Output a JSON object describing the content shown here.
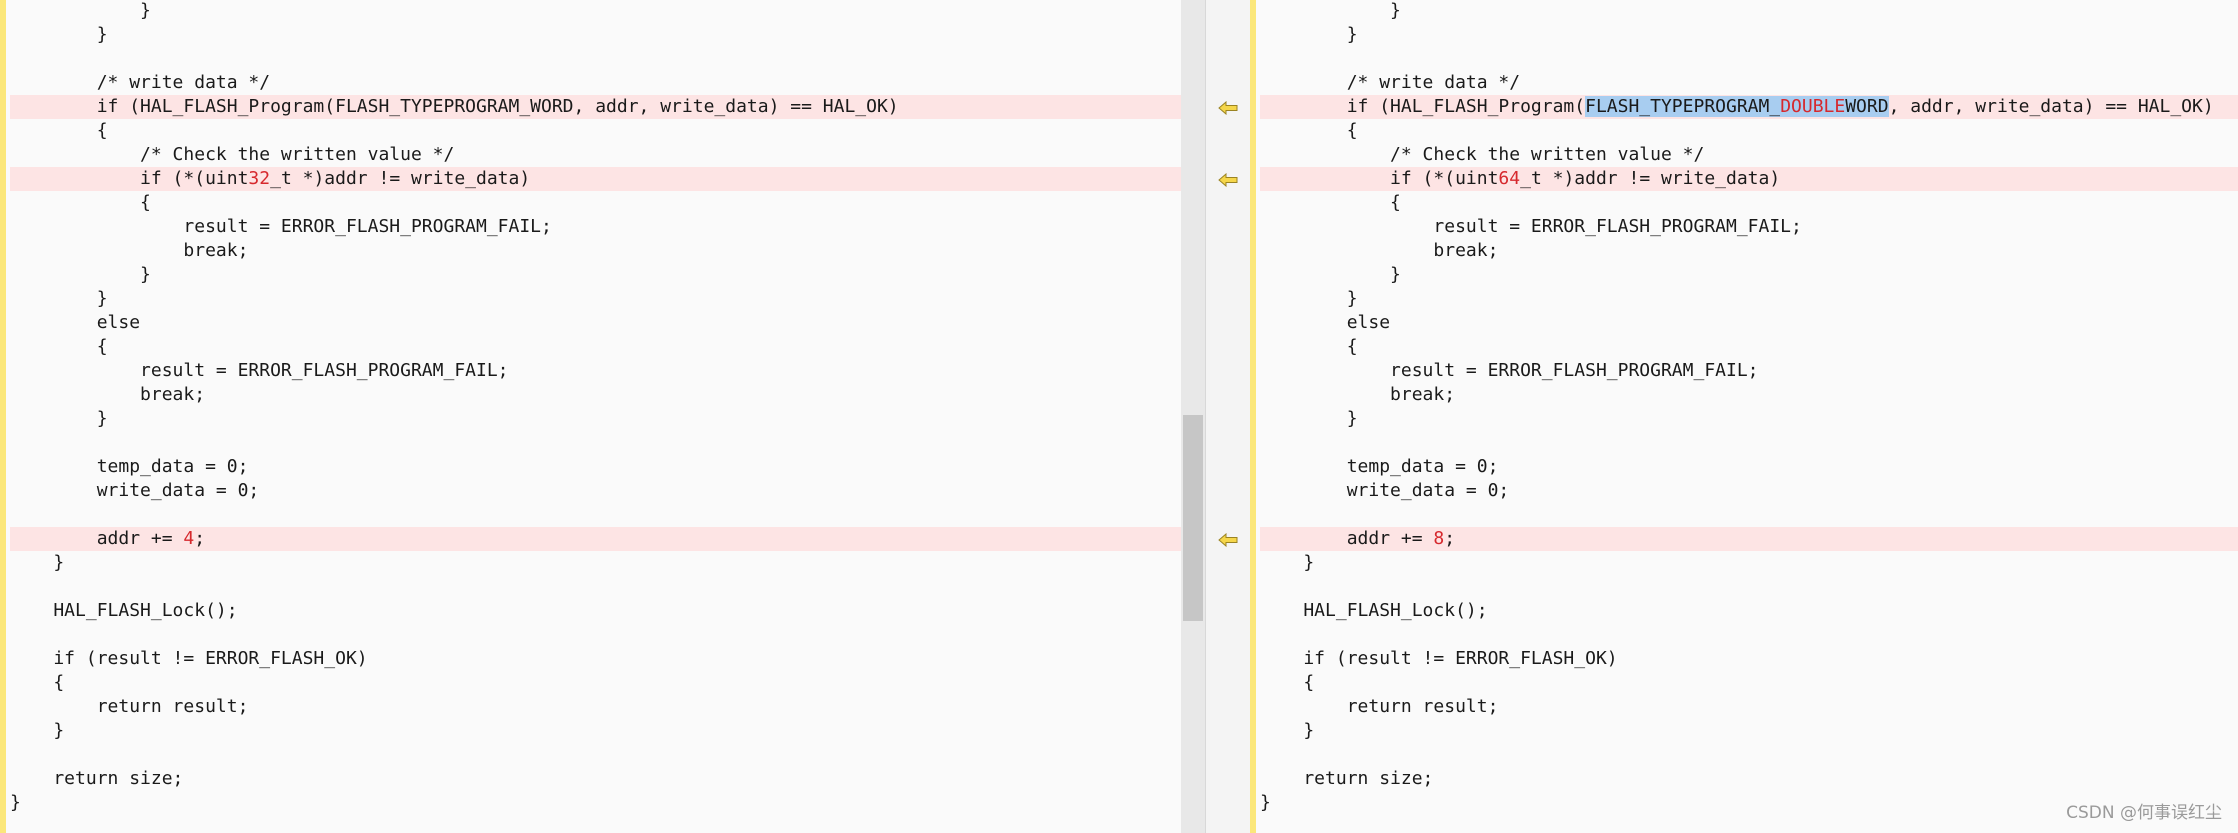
{
  "left_lines": [
    {
      "segments": [
        {
          "t": "            }"
        }
      ]
    },
    {
      "segments": [
        {
          "t": "        }"
        }
      ]
    },
    {
      "segments": [
        {
          "t": ""
        }
      ]
    },
    {
      "segments": [
        {
          "t": "        /* write data */"
        }
      ]
    },
    {
      "diff": true,
      "segments": [
        {
          "t": "        if (HAL_FLASH_Program(FLASH_TYPEPROGRAM_WORD, addr, write_data) == HAL_OK)"
        }
      ]
    },
    {
      "segments": [
        {
          "t": "        {"
        }
      ]
    },
    {
      "segments": [
        {
          "t": "            /* Check the written value */"
        }
      ]
    },
    {
      "diff": true,
      "segments": [
        {
          "t": "            if (*(uint"
        },
        {
          "t": "32",
          "c": "del"
        },
        {
          "t": "_t *)addr != write_data)"
        }
      ]
    },
    {
      "segments": [
        {
          "t": "            {"
        }
      ]
    },
    {
      "segments": [
        {
          "t": "                result = ERROR_FLASH_PROGRAM_FAIL;"
        }
      ]
    },
    {
      "segments": [
        {
          "t": "                break;"
        }
      ]
    },
    {
      "segments": [
        {
          "t": "            }"
        }
      ]
    },
    {
      "segments": [
        {
          "t": "        }"
        }
      ]
    },
    {
      "segments": [
        {
          "t": "        else"
        }
      ]
    },
    {
      "segments": [
        {
          "t": "        {"
        }
      ]
    },
    {
      "segments": [
        {
          "t": "            result = ERROR_FLASH_PROGRAM_FAIL;"
        }
      ]
    },
    {
      "segments": [
        {
          "t": "            break;"
        }
      ]
    },
    {
      "segments": [
        {
          "t": "        }"
        }
      ]
    },
    {
      "segments": [
        {
          "t": ""
        }
      ]
    },
    {
      "segments": [
        {
          "t": "        temp_data = 0;"
        }
      ]
    },
    {
      "segments": [
        {
          "t": "        write_data = 0;"
        }
      ]
    },
    {
      "segments": [
        {
          "t": ""
        }
      ]
    },
    {
      "diff": true,
      "segments": [
        {
          "t": "        addr += "
        },
        {
          "t": "4",
          "c": "del"
        },
        {
          "t": ";"
        }
      ]
    },
    {
      "segments": [
        {
          "t": "    }"
        }
      ]
    },
    {
      "segments": [
        {
          "t": ""
        }
      ]
    },
    {
      "segments": [
        {
          "t": "    HAL_FLASH_Lock();"
        }
      ]
    },
    {
      "segments": [
        {
          "t": ""
        }
      ]
    },
    {
      "segments": [
        {
          "t": "    if (result != ERROR_FLASH_OK)"
        }
      ]
    },
    {
      "segments": [
        {
          "t": "    {"
        }
      ]
    },
    {
      "segments": [
        {
          "t": "        return result;"
        }
      ]
    },
    {
      "segments": [
        {
          "t": "    }"
        }
      ]
    },
    {
      "segments": [
        {
          "t": ""
        }
      ]
    },
    {
      "segments": [
        {
          "t": "    return size;"
        }
      ]
    },
    {
      "segments": [
        {
          "t": "}"
        }
      ]
    }
  ],
  "right_lines": [
    {
      "segments": [
        {
          "t": "            }"
        }
      ]
    },
    {
      "segments": [
        {
          "t": "        }"
        }
      ]
    },
    {
      "segments": [
        {
          "t": ""
        }
      ]
    },
    {
      "segments": [
        {
          "t": "        /* write data */"
        }
      ]
    },
    {
      "diff": true,
      "segments": [
        {
          "t": "        if (HAL_FLASH_Program("
        },
        {
          "t": "FLASH_TYPEPROGRAM_",
          "c": "sel"
        },
        {
          "t": "DOUBLE",
          "c": "seldel"
        },
        {
          "t": "WORD",
          "c": "sel"
        },
        {
          "t": ", addr, write_data) == HAL_OK)"
        }
      ]
    },
    {
      "segments": [
        {
          "t": "        {"
        }
      ]
    },
    {
      "segments": [
        {
          "t": "            /* Check the written value */"
        }
      ]
    },
    {
      "diff": true,
      "segments": [
        {
          "t": "            if (*(uint"
        },
        {
          "t": "64",
          "c": "del"
        },
        {
          "t": "_t *)addr != write_data)"
        }
      ]
    },
    {
      "segments": [
        {
          "t": "            {"
        }
      ]
    },
    {
      "segments": [
        {
          "t": "                result = ERROR_FLASH_PROGRAM_FAIL;"
        }
      ]
    },
    {
      "segments": [
        {
          "t": "                break;"
        }
      ]
    },
    {
      "segments": [
        {
          "t": "            }"
        }
      ]
    },
    {
      "segments": [
        {
          "t": "        }"
        }
      ]
    },
    {
      "segments": [
        {
          "t": "        else"
        }
      ]
    },
    {
      "segments": [
        {
          "t": "        {"
        }
      ]
    },
    {
      "segments": [
        {
          "t": "            result = ERROR_FLASH_PROGRAM_FAIL;"
        }
      ]
    },
    {
      "segments": [
        {
          "t": "            break;"
        }
      ]
    },
    {
      "segments": [
        {
          "t": "        }"
        }
      ]
    },
    {
      "segments": [
        {
          "t": ""
        }
      ]
    },
    {
      "segments": [
        {
          "t": "        temp_data = 0;"
        }
      ]
    },
    {
      "segments": [
        {
          "t": "        write_data = 0;"
        }
      ]
    },
    {
      "segments": [
        {
          "t": ""
        }
      ]
    },
    {
      "diff": true,
      "segments": [
        {
          "t": "        addr += "
        },
        {
          "t": "8",
          "c": "del"
        },
        {
          "t": ";"
        }
      ]
    },
    {
      "segments": [
        {
          "t": "    }"
        }
      ]
    },
    {
      "segments": [
        {
          "t": ""
        }
      ]
    },
    {
      "segments": [
        {
          "t": "    HAL_FLASH_Lock();"
        }
      ]
    },
    {
      "segments": [
        {
          "t": ""
        }
      ]
    },
    {
      "segments": [
        {
          "t": "    if (result != ERROR_FLASH_OK)"
        }
      ]
    },
    {
      "segments": [
        {
          "t": "    {"
        }
      ]
    },
    {
      "segments": [
        {
          "t": "        return result;"
        }
      ]
    },
    {
      "segments": [
        {
          "t": "    }"
        }
      ]
    },
    {
      "segments": [
        {
          "t": ""
        }
      ]
    },
    {
      "segments": [
        {
          "t": "    return size;"
        }
      ]
    },
    {
      "segments": [
        {
          "t": "}"
        }
      ]
    }
  ],
  "merge_arrows": [
    {
      "icon": "copy-left-arrow-icon",
      "line": 4
    },
    {
      "icon": "copy-left-arrow-icon",
      "line": 7
    },
    {
      "icon": "copy-left-arrow-icon",
      "line": 22
    }
  ],
  "watermark": "CSDN @何事误红尘",
  "colors": {
    "diff_bg": "#fde4e4",
    "changed_text": "#d6282d",
    "selection": "#a8cdf0",
    "gutter": "#fbe77a",
    "arrow_fill": "#f5d64a"
  }
}
